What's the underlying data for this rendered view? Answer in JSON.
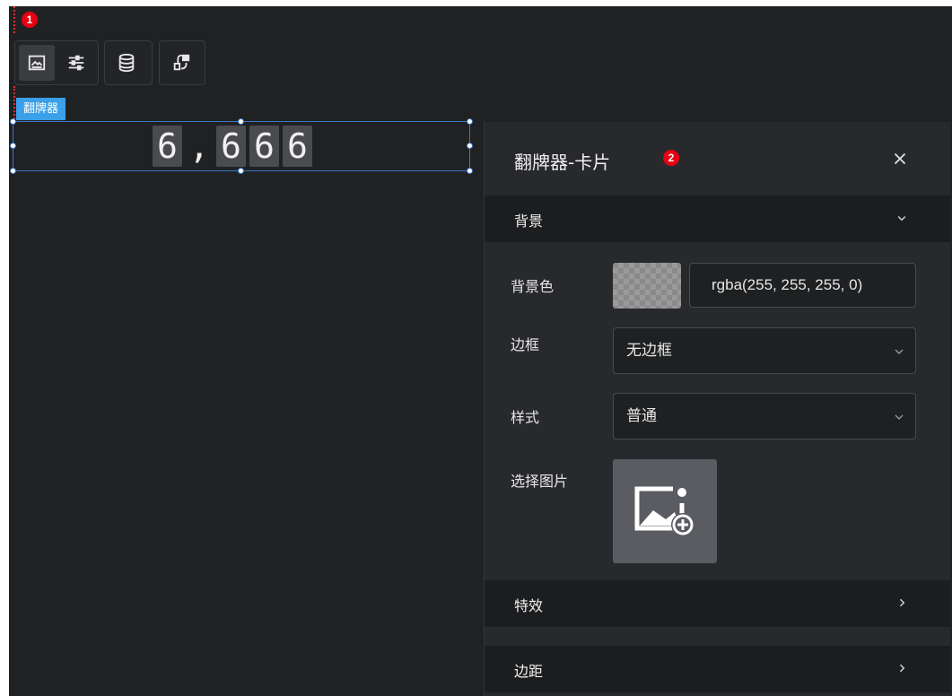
{
  "badges": {
    "first": "1",
    "second": "2"
  },
  "toolbar": {
    "items": [
      {
        "icon": "image-icon",
        "active": true
      },
      {
        "icon": "sliders-icon",
        "active": false
      },
      {
        "icon": "database-icon",
        "active": false
      },
      {
        "icon": "link-icon",
        "active": false
      }
    ]
  },
  "component": {
    "label": "翻牌器",
    "digits": [
      "6",
      ",",
      "6",
      "6",
      "6"
    ]
  },
  "panel": {
    "title": "翻牌器-卡片",
    "sections": {
      "background": "背景",
      "effects": "特效",
      "margin": "边距"
    },
    "fields": {
      "bg_color_label": "背景色",
      "bg_color_value": "rgba(255, 255, 255, 0)",
      "border_label": "边框",
      "border_value": "无边框",
      "style_label": "样式",
      "style_value": "普通",
      "image_label": "选择图片"
    }
  },
  "colors": {
    "canvas": "#202123",
    "panel": "#28292c",
    "accent": "#3aa0e8",
    "badge": "#e60012"
  }
}
